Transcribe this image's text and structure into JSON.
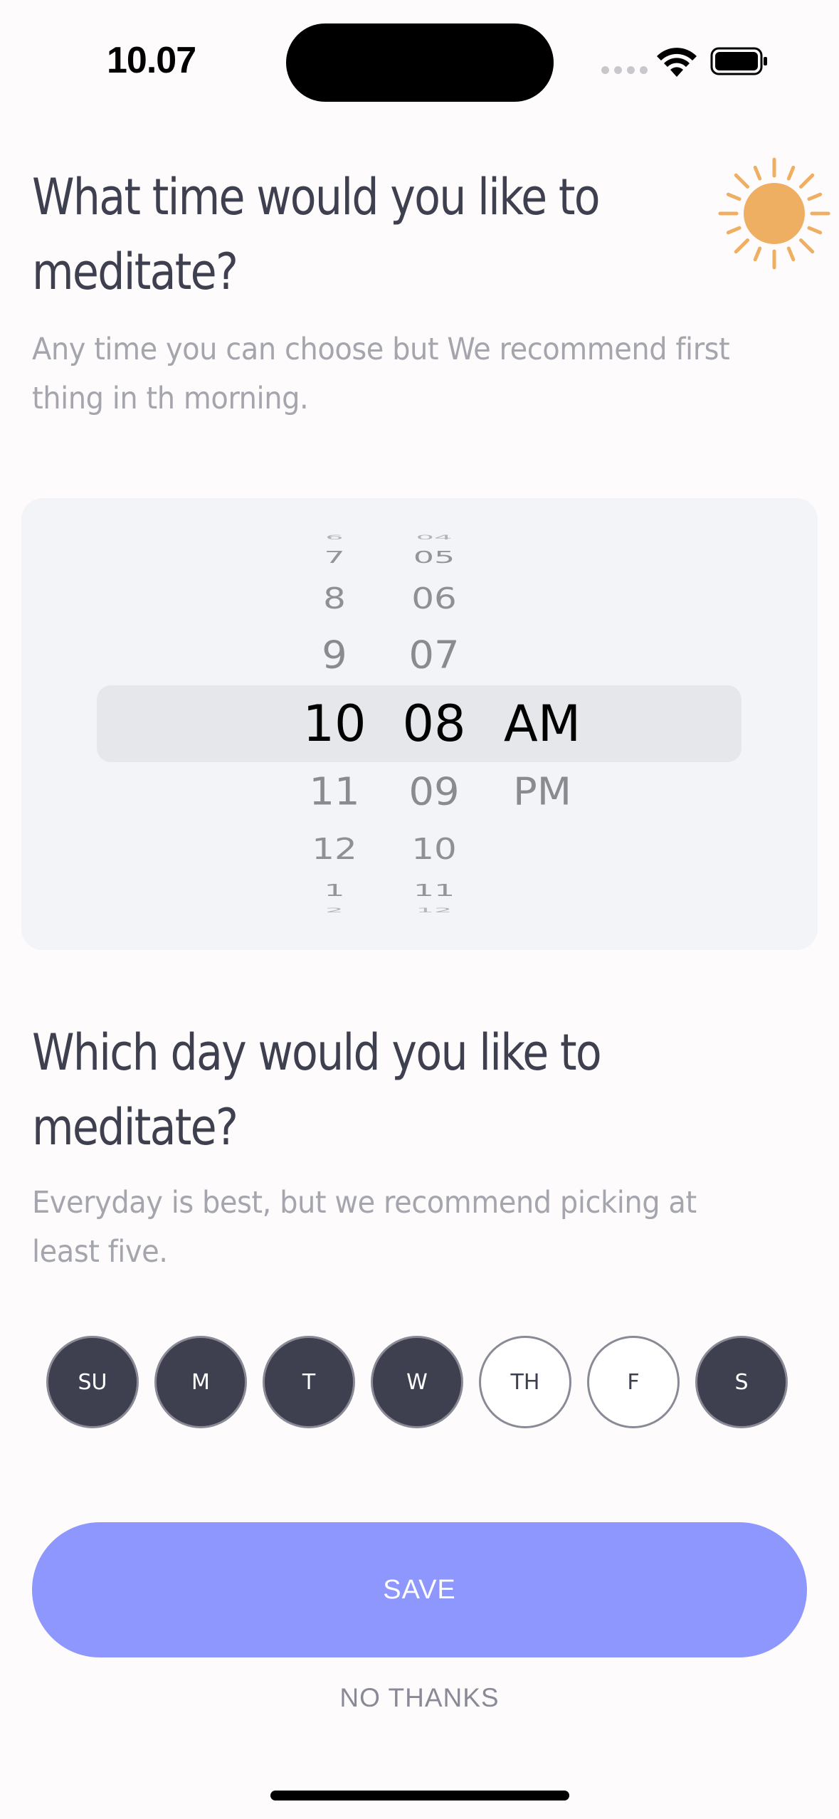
{
  "status_bar": {
    "time": "10.07"
  },
  "time_section": {
    "title": "What time would you like to meditate?",
    "subtitle": "Any time you can choose but We recommend first thing in th morning."
  },
  "time_picker": {
    "hours": [
      "6",
      "7",
      "8",
      "9",
      "10",
      "11",
      "12",
      "1",
      "2"
    ],
    "minutes": [
      "04",
      "05",
      "06",
      "07",
      "08",
      "09",
      "10",
      "11",
      "12"
    ],
    "periods": [
      "AM",
      "PM"
    ],
    "selected": {
      "hour": "10",
      "minute": "08",
      "period": "AM"
    }
  },
  "day_section": {
    "title": "Which day would you like to meditate?",
    "subtitle": "Everyday is best, but we recommend picking at least five."
  },
  "days": [
    {
      "label": "SU",
      "selected": true
    },
    {
      "label": "M",
      "selected": true
    },
    {
      "label": "T",
      "selected": true
    },
    {
      "label": "W",
      "selected": true
    },
    {
      "label": "TH",
      "selected": false
    },
    {
      "label": "F",
      "selected": false
    },
    {
      "label": "S",
      "selected": true
    }
  ],
  "actions": {
    "save_label": "SAVE",
    "no_thanks_label": "NO THANKS"
  },
  "colors": {
    "accent": "#8e97fd",
    "day_selected": "#3e404f",
    "sun": "#efaf63",
    "background": "#fefbfd"
  },
  "icons": [
    "sun-icon",
    "wifi-icon",
    "battery-icon",
    "cellular-signal-icon"
  ]
}
